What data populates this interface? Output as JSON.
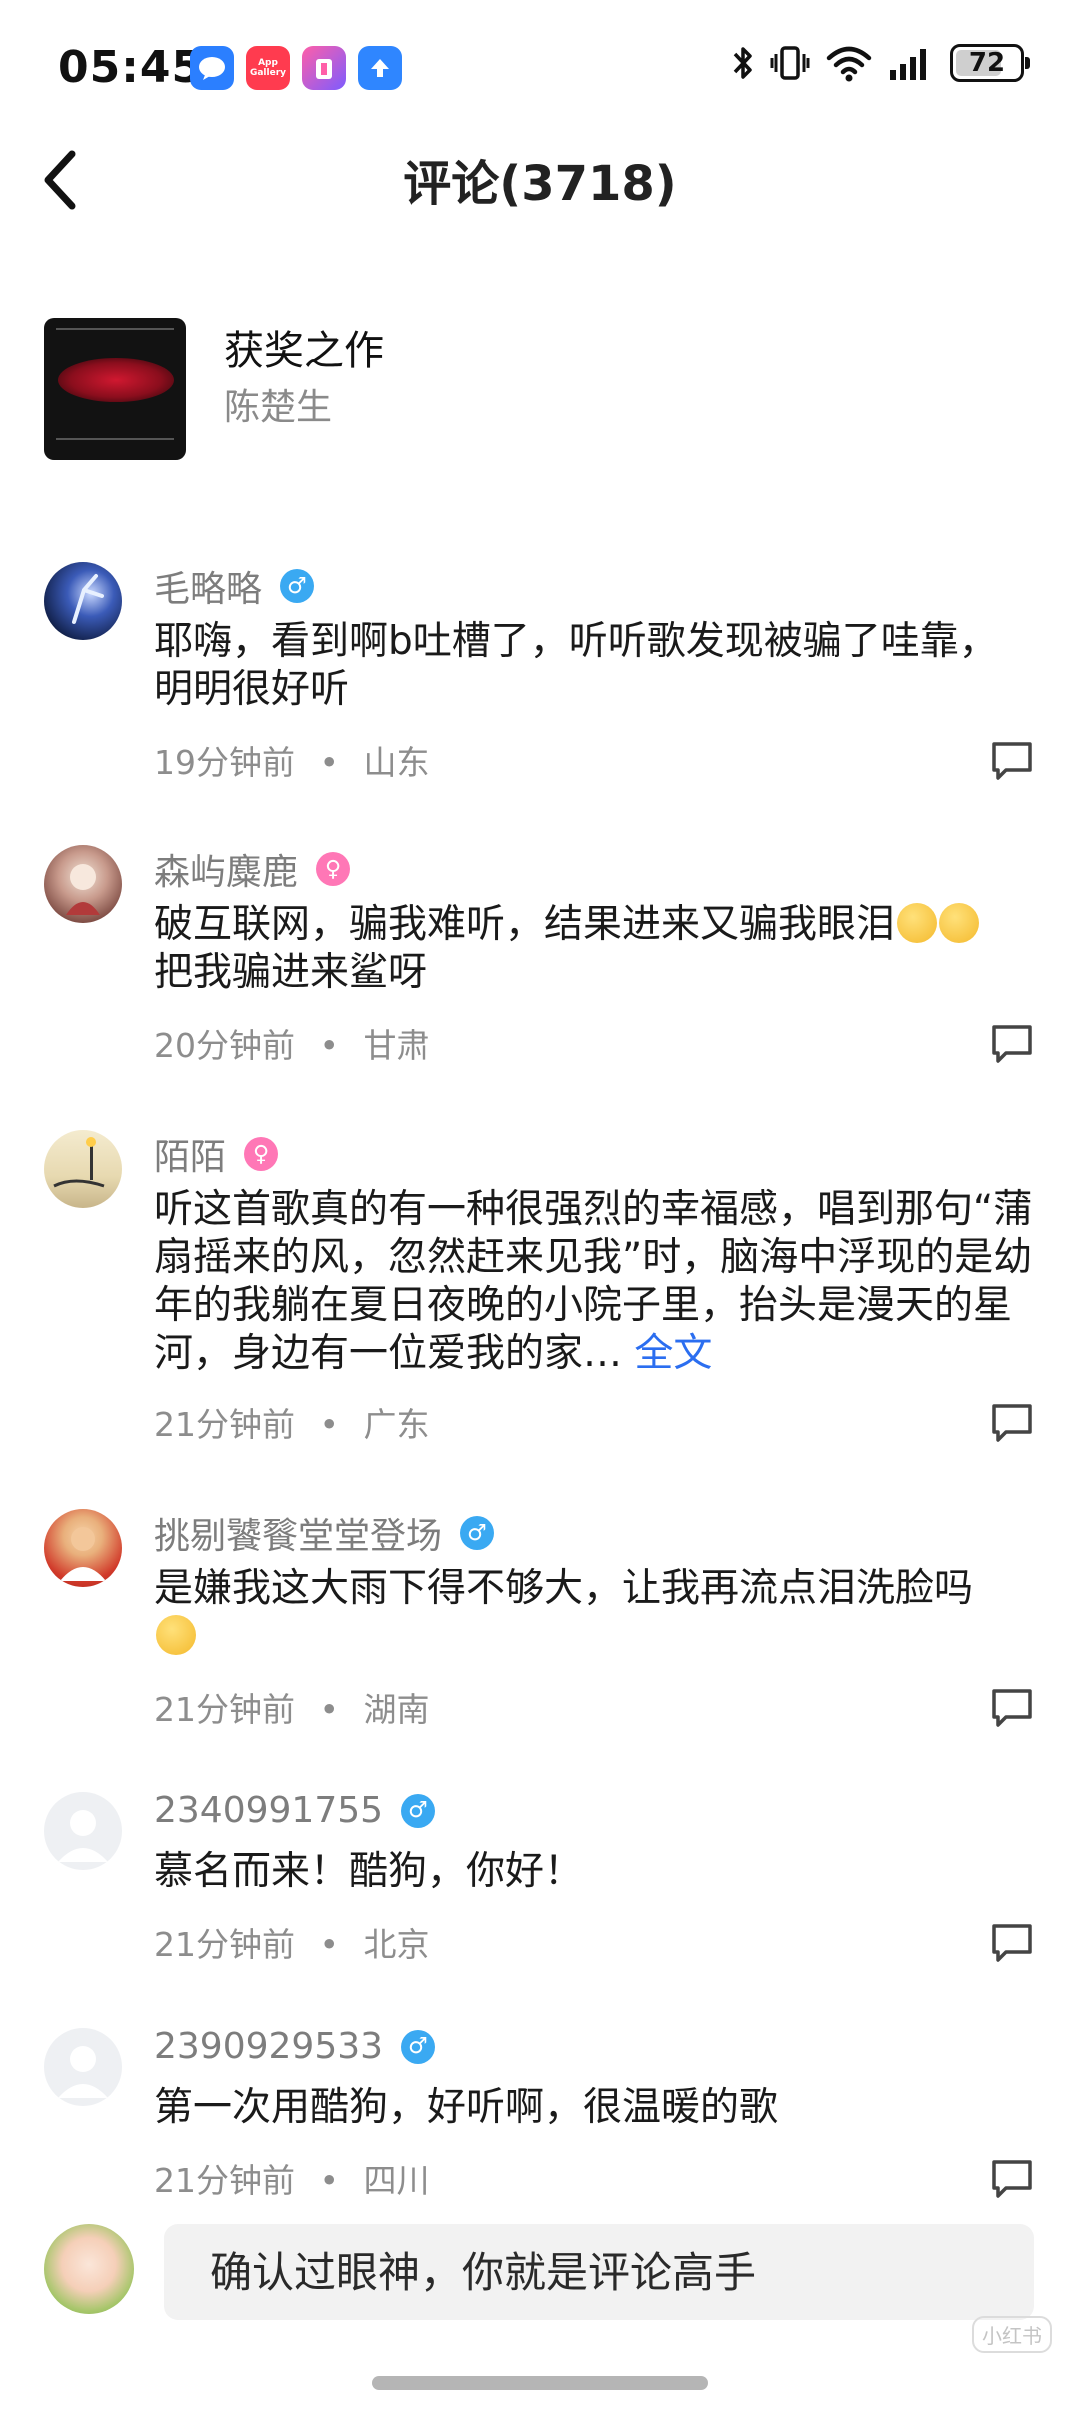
{
  "status_bar": {
    "time": "05:45",
    "app_icons": [
      "message-icon",
      "app-gallery-icon",
      "shop-icon",
      "update-icon"
    ],
    "app_gallery_label": "App Gallery",
    "battery": "72",
    "battery_level": 0.72,
    "icons": [
      "bluetooth-icon",
      "vibrate-icon",
      "wifi-icon",
      "cellular-signal-icon",
      "battery-icon"
    ]
  },
  "header": {
    "title": "评论(3718)",
    "back_icon": "chevron-left-icon"
  },
  "song": {
    "title": "获奖之作",
    "artist": "陈楚生"
  },
  "comments": [
    {
      "name": "毛略略",
      "gender": "male",
      "gender_symbol": "♂",
      "text": "耶嗨，看到啊b吐槽了，听听歌发现被骗了哇靠，明明很好听",
      "time": "19分钟前",
      "location": "山东"
    },
    {
      "name": "森屿麋鹿",
      "gender": "female",
      "gender_symbol": "♀",
      "text": "破互联网，骗我难听，结果进来又骗我眼泪",
      "text_after": "把我骗进来鲨呀",
      "emojis": [
        "crying-emoji",
        "crying-emoji"
      ],
      "time": "20分钟前",
      "location": "甘肃"
    },
    {
      "name": "陌陌",
      "gender": "female",
      "gender_symbol": "♀",
      "text": "听这首歌真的有一种很强烈的幸福感，唱到那句“蒲扇摇来的风，忽然赶来见我”时，脑海中浮现的是幼年的我躺在夏日夜晚的小院子里，抬头是漫天的星河，身边有一位爱我的家…",
      "full_text_link": "全文",
      "time": "21分钟前",
      "location": "广东"
    },
    {
      "name": "挑剔饕餮堂堂登场",
      "gender": "male",
      "gender_symbol": "♂",
      "text": "是嫌我这大雨下得不够大，让我再流点泪洗脸吗",
      "emojis": [
        "smiling-emoji"
      ],
      "time": "21分钟前",
      "location": "湖南"
    },
    {
      "name": "2340991755",
      "gender": "male",
      "gender_symbol": "♂",
      "text": "慕名而来！酷狗，你好！",
      "time": "21分钟前",
      "location": "北京"
    },
    {
      "name": "2390929533",
      "gender": "male",
      "gender_symbol": "♂",
      "text": "第一次用酷狗，好听啊，很温暖的歌",
      "time": "21分钟前",
      "location": "四川"
    }
  ],
  "meta_separator": "•",
  "input": {
    "placeholder": "确认过眼神，你就是评论高手"
  },
  "watermark": "小红书",
  "colors": {
    "male": "#3aa9f2",
    "female": "#ff77b6",
    "link": "#2b6ef0",
    "muted_text": "#8d8d8d"
  }
}
